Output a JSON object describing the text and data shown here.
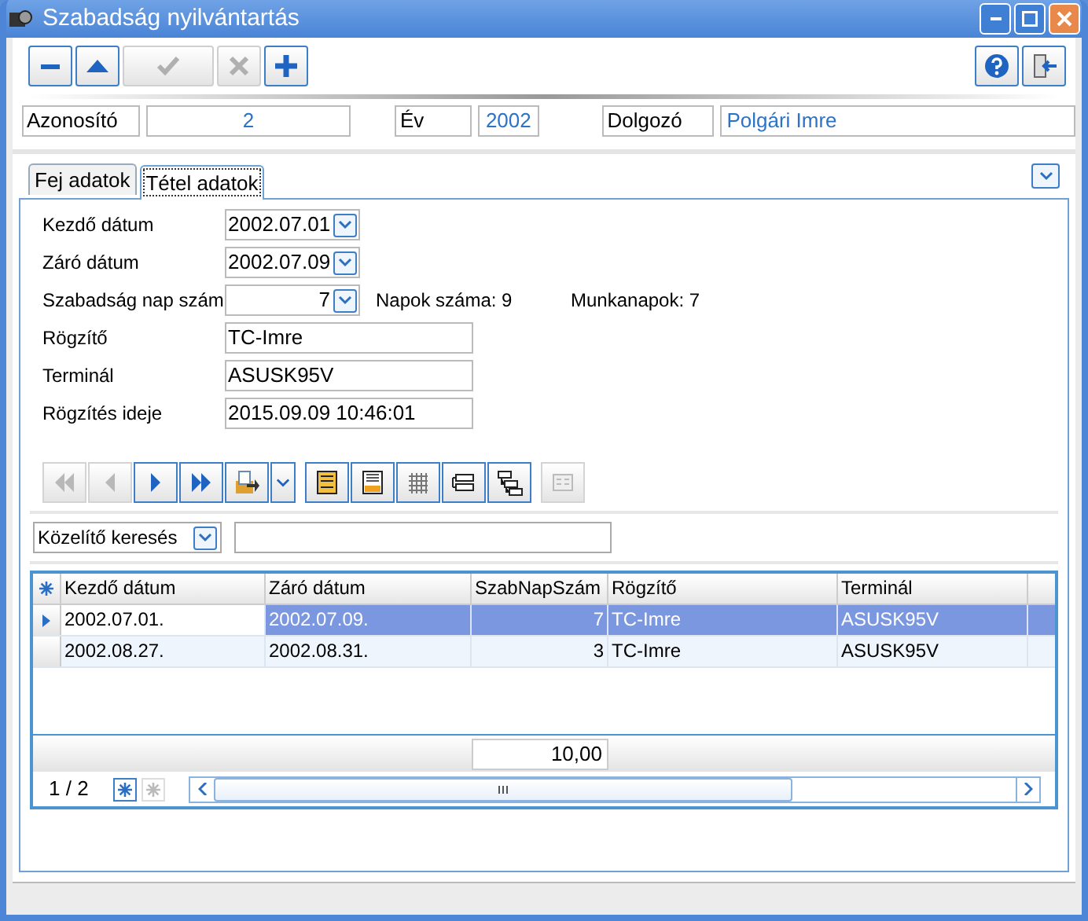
{
  "window": {
    "title": "Szabadság nyilvántartás"
  },
  "toolbar": {
    "buttons": [
      {
        "kind": "minus",
        "disabled": false
      },
      {
        "kind": "up",
        "disabled": false
      },
      {
        "kind": "check",
        "disabled": true
      },
      {
        "kind": "cross",
        "disabled": true
      },
      {
        "kind": "plus",
        "disabled": false
      }
    ],
    "right_buttons": [
      {
        "kind": "help",
        "disabled": false
      },
      {
        "kind": "exit",
        "disabled": false
      }
    ]
  },
  "header": {
    "fields": [
      {
        "label": "Azonosító",
        "value": "2",
        "kind": "number"
      },
      {
        "label": "Év",
        "value": "2002",
        "kind": "number"
      },
      {
        "label": "Dolgozó",
        "value": "Polgári Imre",
        "kind": "text"
      }
    ]
  },
  "tabs": [
    {
      "label": "Fej adatok",
      "selected": false
    },
    {
      "label": "Tétel adatok",
      "selected": true
    }
  ],
  "form": {
    "fields": [
      {
        "label": "Kezdő dátum",
        "value": "2002.07.01",
        "kind": "dropdown"
      },
      {
        "label": "Záró dátum",
        "value": "2002.07.09",
        "kind": "dropdown"
      },
      {
        "label": "Szabadság nap szám",
        "value": "7",
        "kind": "number-dropdown",
        "notes": [
          "Napok száma: 9",
          "Munkanapok: 7"
        ]
      },
      {
        "label": "Rögzítő",
        "value": "TC-Imre",
        "kind": "text"
      },
      {
        "label": "Terminál",
        "value": "ASUSK95V",
        "kind": "text"
      },
      {
        "label": "Rögzítés ideje",
        "value": "2015.09.09 10:46:01",
        "kind": "text"
      }
    ]
  },
  "nav_toolbar": {
    "buttons": [
      {
        "kind": "first",
        "disabled": true
      },
      {
        "kind": "prev",
        "disabled": true
      },
      {
        "kind": "next",
        "disabled": false
      },
      {
        "kind": "last",
        "disabled": false
      },
      {
        "kind": "export",
        "disabled": false
      },
      {
        "kind": "caret",
        "disabled": false
      },
      {
        "kind": "form-view",
        "disabled": false
      },
      {
        "kind": "footer-view",
        "disabled": false
      },
      {
        "kind": "grid",
        "disabled": false
      },
      {
        "kind": "group",
        "disabled": false
      },
      {
        "kind": "tree",
        "disabled": false
      },
      {
        "kind": "card",
        "disabled": true
      }
    ]
  },
  "search": {
    "mode": "Közelítő keresés"
  },
  "grid": {
    "columns": [
      {
        "label": "Kezdő dátum",
        "kind": "date"
      },
      {
        "label": "Záró dátum",
        "kind": "date"
      },
      {
        "label": "SzabNapSzám",
        "kind": "number"
      },
      {
        "label": "Rögzítő",
        "kind": "text"
      },
      {
        "label": "Terminál",
        "kind": "text"
      }
    ],
    "rows": [
      {
        "cells": [
          "2002.07.01.",
          "2002.07.09.",
          "7",
          "TC-Imre",
          "ASUSK95V"
        ],
        "selected": true
      },
      {
        "cells": [
          "2002.08.27.",
          "2002.08.31.",
          "3",
          "TC-Imre",
          "ASUSK95V"
        ],
        "selected": false
      }
    ],
    "footer": {
      "value": "10,00"
    },
    "pager": "1 / 2"
  }
}
